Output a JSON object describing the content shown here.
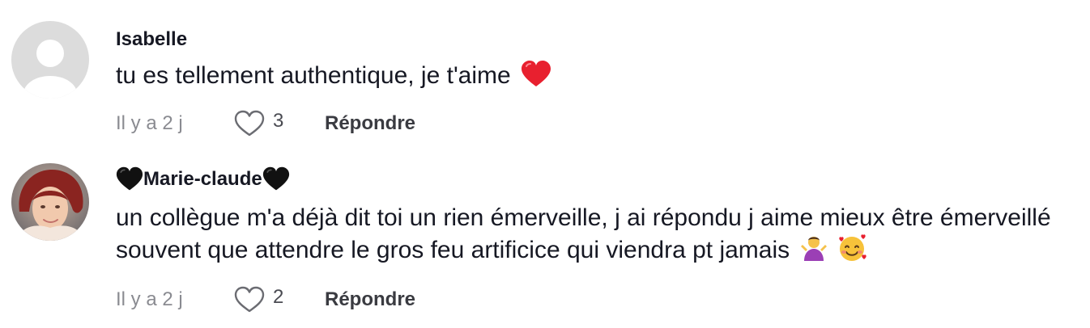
{
  "comments": [
    {
      "username": "Isabelle",
      "text": "tu es tellement authentique, je t'aime",
      "emoji_icon": "red-heart-icon",
      "time": "Il y a 2 j",
      "likes": "3",
      "reply_label": "Répondre"
    },
    {
      "username": "Marie-claude",
      "username_decoration_icon": "black-heart-icon",
      "text": "un collègue m'a déjà dit toi un rien émerveille, j ai répondu j aime mieux être émerveillé souvent que attendre le gros feu artificice qui viendra pt jamais",
      "emoji_icons": [
        "person-shrugging-icon",
        "smiling-face-with-hearts-icon"
      ],
      "time": "Il y a 2 j",
      "likes": "2",
      "reply_label": "Répondre"
    }
  ],
  "colors": {
    "text": "#161823",
    "muted": "#8a8b91",
    "heart_red": "#e8202f"
  }
}
